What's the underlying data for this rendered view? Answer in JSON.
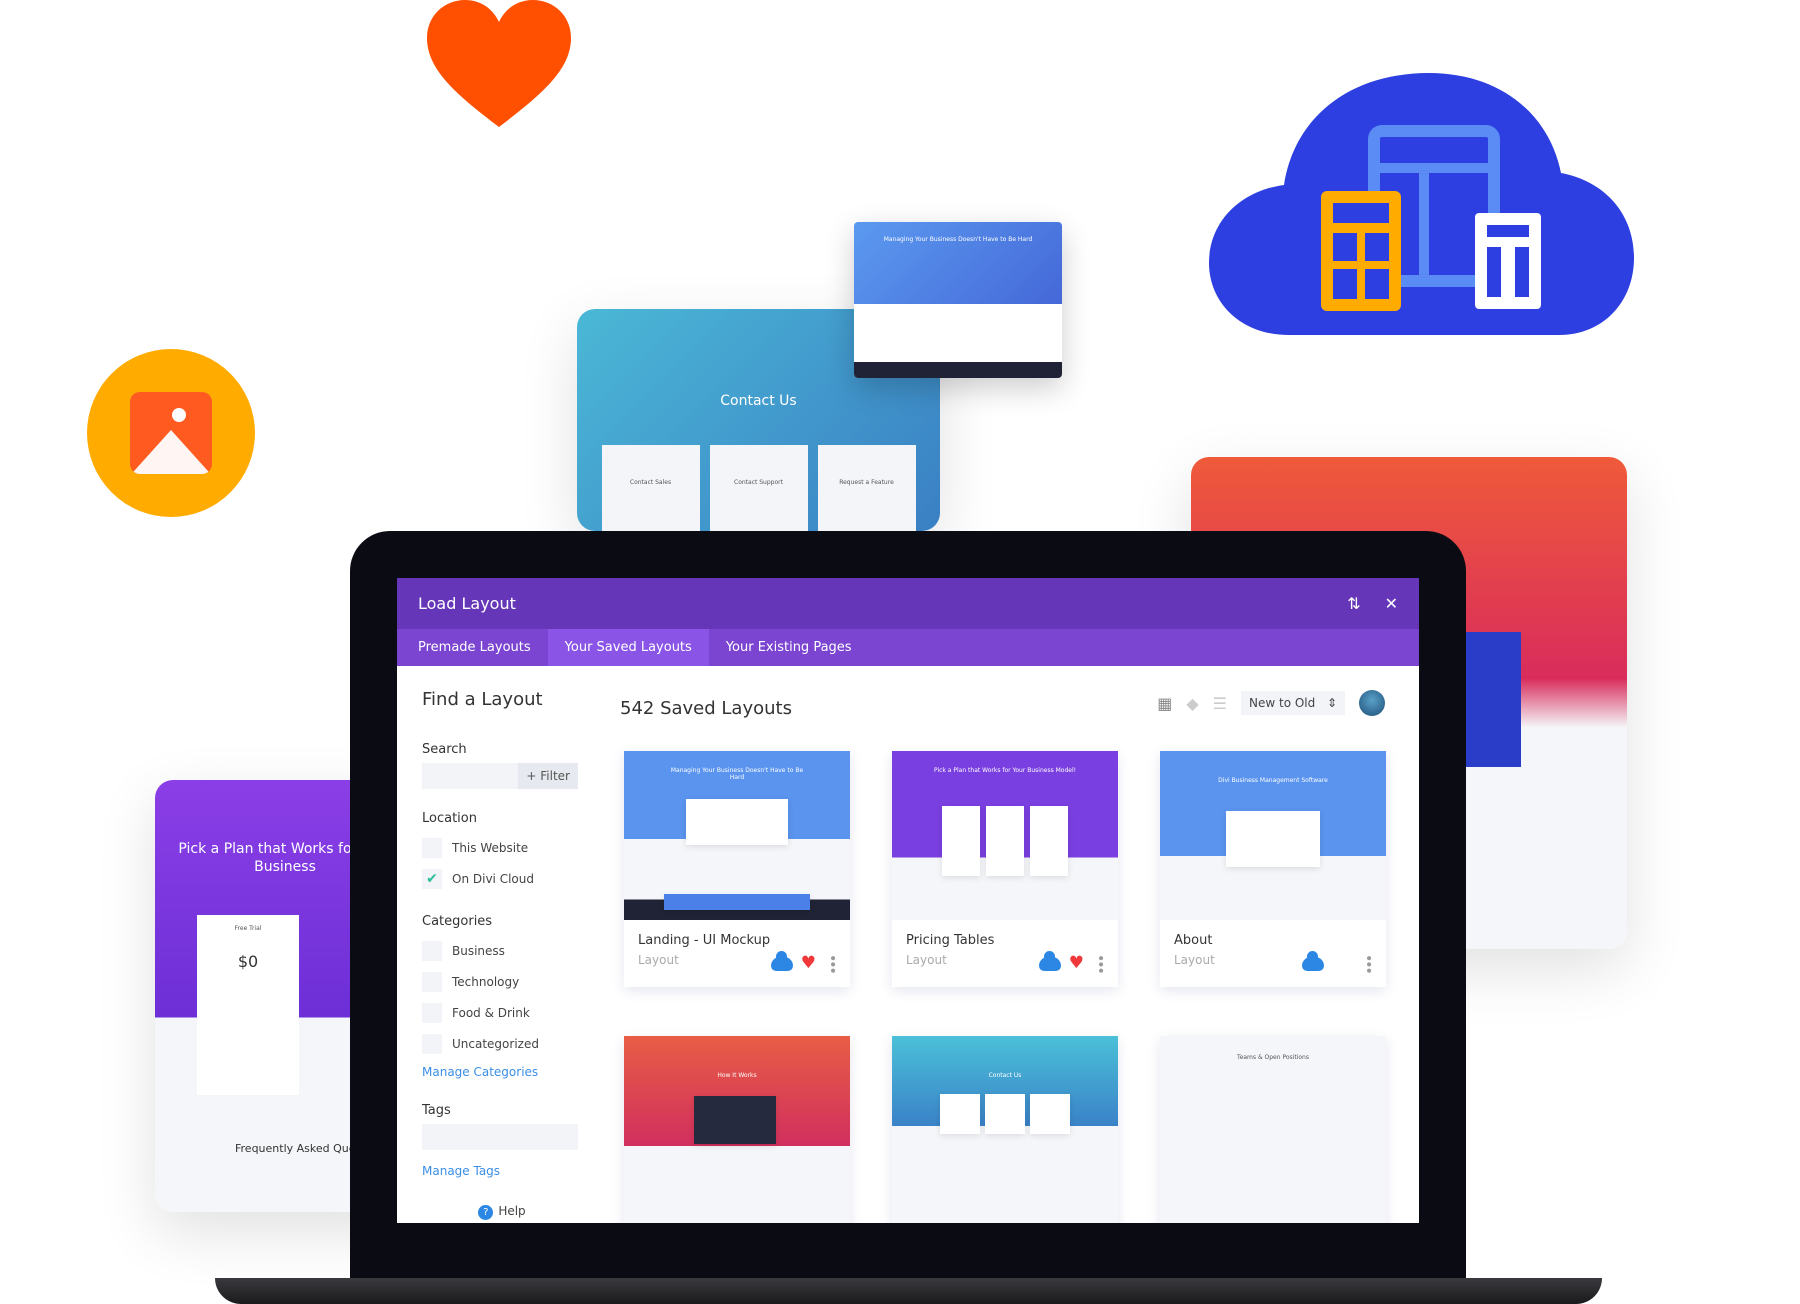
{
  "colors": {
    "header": "#6536b7",
    "tabs": "#7b45d1",
    "active_tab": "#8a55e6",
    "cloud": "#2d3fe0",
    "heart": "#ff4f00",
    "image_badge": "#ffab00",
    "link": "#3b8ee6",
    "favorite": "#f0383b"
  },
  "decor": {
    "contact_card": {
      "title": "Contact Us",
      "boxes": [
        "Contact Sales",
        "Contact Support",
        "Request a Feature"
      ]
    },
    "landing_card": {
      "title": "Managing Your Business Doesn't Have to Be Hard"
    },
    "pricing_card": {
      "title": "Pick a Plan that Works for Your Business",
      "plan": "Free Trial",
      "price": "$0",
      "faq": "Frequently Asked Questions"
    }
  },
  "modal": {
    "title": "Load Layout",
    "icons": {
      "sort": "sort-icon",
      "close": "close-icon"
    },
    "tabs": [
      {
        "label": "Premade Layouts"
      },
      {
        "label": "Your Saved Layouts",
        "active": true
      },
      {
        "label": "Your Existing Pages"
      }
    ],
    "sidebar": {
      "heading": "Find a Layout",
      "search_label": "Search",
      "search_value": "",
      "filter_label": "+ Filter",
      "location_label": "Location",
      "locations": [
        {
          "label": "This Website",
          "checked": false
        },
        {
          "label": "On Divi Cloud",
          "checked": true
        }
      ],
      "categories_label": "Categories",
      "categories": [
        {
          "label": "Business"
        },
        {
          "label": "Technology"
        },
        {
          "label": "Food & Drink"
        },
        {
          "label": "Uncategorized"
        }
      ],
      "manage_categories": "Manage Categories",
      "tags_label": "Tags",
      "manage_tags": "Manage Tags",
      "help": "Help"
    },
    "main": {
      "title": "542 Saved Layouts",
      "view_icons": [
        "grid-icon",
        "tag-icon",
        "list-icon"
      ],
      "sort_value": "New to Old",
      "cards": [
        {
          "name": "Landing - UI Mockup",
          "type": "Layout",
          "thumb_title": "Managing Your Business Doesn't Have to Be Hard",
          "cloud": true,
          "favorite": true
        },
        {
          "name": "Pricing Tables",
          "type": "Layout",
          "thumb_title": "Pick a Plan that Works for Your Business Model!",
          "cloud": true,
          "favorite": true
        },
        {
          "name": "About",
          "type": "Layout",
          "thumb_title": "Divi Business Management Software",
          "cloud": true,
          "favorite": false
        },
        {
          "thumb_title": "How It Works"
        },
        {
          "thumb_title": "Contact Us"
        },
        {
          "thumb_title": "Teams & Open Positions"
        }
      ]
    }
  }
}
